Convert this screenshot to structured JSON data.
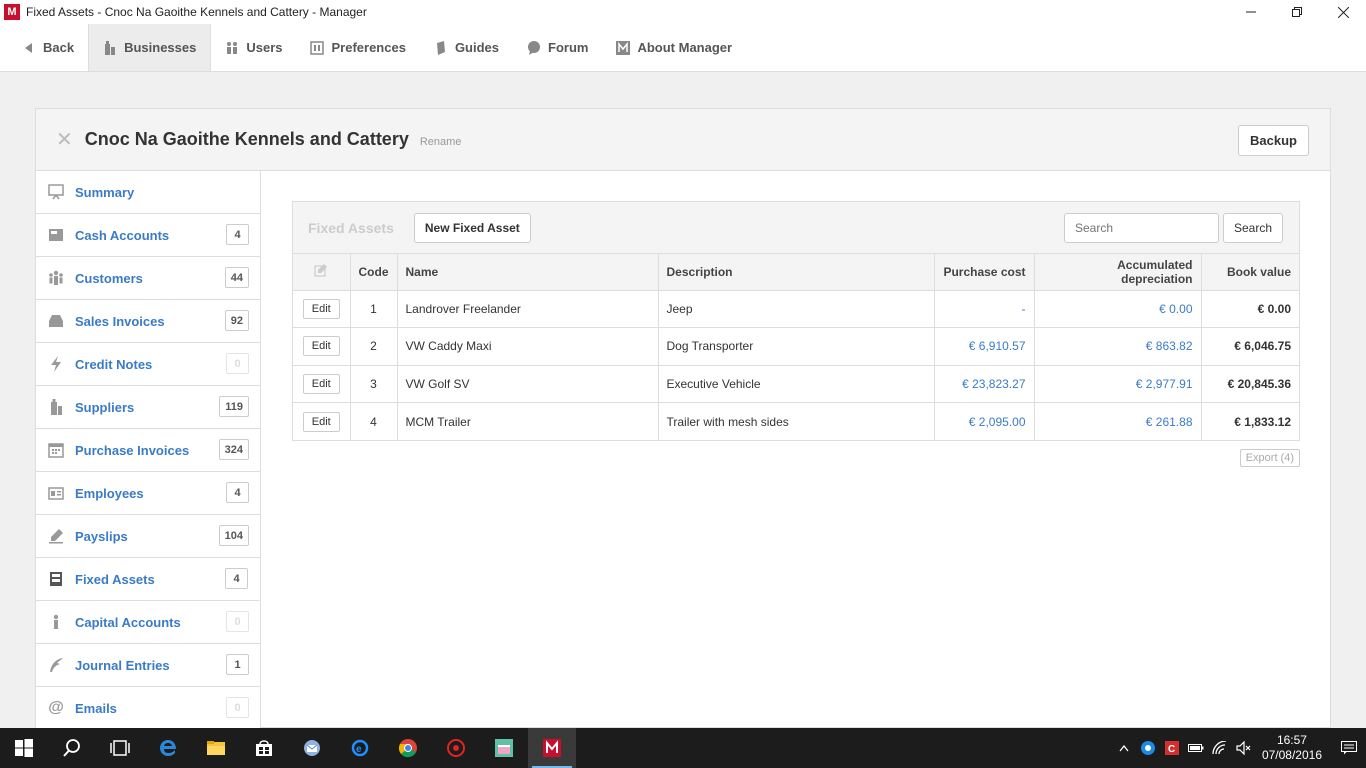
{
  "window": {
    "title": "Fixed Assets - Cnoc Na Gaoithe Kennels and Cattery - Manager",
    "app_logo": "M"
  },
  "nav": {
    "back": "Back",
    "businesses": "Businesses",
    "users": "Users",
    "preferences": "Preferences",
    "guides": "Guides",
    "forum": "Forum",
    "about": "About Manager"
  },
  "business": {
    "name": "Cnoc Na Gaoithe Kennels and Cattery",
    "rename": "Rename",
    "backup": "Backup"
  },
  "sidebar": {
    "items": [
      {
        "label": "Summary",
        "count": ""
      },
      {
        "label": "Cash Accounts",
        "count": "4"
      },
      {
        "label": "Customers",
        "count": "44"
      },
      {
        "label": "Sales Invoices",
        "count": "92"
      },
      {
        "label": "Credit Notes",
        "count": "0"
      },
      {
        "label": "Suppliers",
        "count": "119"
      },
      {
        "label": "Purchase Invoices",
        "count": "324"
      },
      {
        "label": "Employees",
        "count": "4"
      },
      {
        "label": "Payslips",
        "count": "104"
      },
      {
        "label": "Fixed Assets",
        "count": "4"
      },
      {
        "label": "Capital Accounts",
        "count": "0"
      },
      {
        "label": "Journal Entries",
        "count": "1"
      },
      {
        "label": "Emails",
        "count": "0"
      }
    ]
  },
  "fixed_assets": {
    "title": "Fixed Assets",
    "new_button": "New Fixed Asset",
    "search_placeholder": "Search",
    "search_button": "Search",
    "columns": {
      "code": "Code",
      "name": "Name",
      "description": "Description",
      "purchase_cost": "Purchase cost",
      "accumulated_depreciation": "Accumulated depreciation",
      "book_value": "Book value"
    },
    "edit_label": "Edit",
    "rows": [
      {
        "code": "1",
        "name": "Landrover Freelander",
        "description": "Jeep",
        "purchase_cost": "-",
        "accumulated_depreciation": "€ 0.00",
        "book_value": "€ 0.00"
      },
      {
        "code": "2",
        "name": "VW Caddy Maxi",
        "description": "Dog Transporter",
        "purchase_cost": "€ 6,910.57",
        "accumulated_depreciation": "€ 863.82",
        "book_value": "€ 6,046.75"
      },
      {
        "code": "3",
        "name": "VW Golf SV",
        "description": "Executive Vehicle",
        "purchase_cost": "€ 23,823.27",
        "accumulated_depreciation": "€ 2,977.91",
        "book_value": "€ 20,845.36"
      },
      {
        "code": "4",
        "name": "MCM Trailer",
        "description": "Trailer with mesh sides",
        "purchase_cost": "€ 2,095.00",
        "accumulated_depreciation": "€ 261.88",
        "book_value": "€ 1,833.12"
      }
    ],
    "export": "Export (4)"
  },
  "taskbar": {
    "time": "16:57",
    "date": "07/08/2016"
  },
  "colors": {
    "link": "#3a7bc8",
    "taskbar": "#1c1c1c",
    "brand": "#c8102e"
  }
}
